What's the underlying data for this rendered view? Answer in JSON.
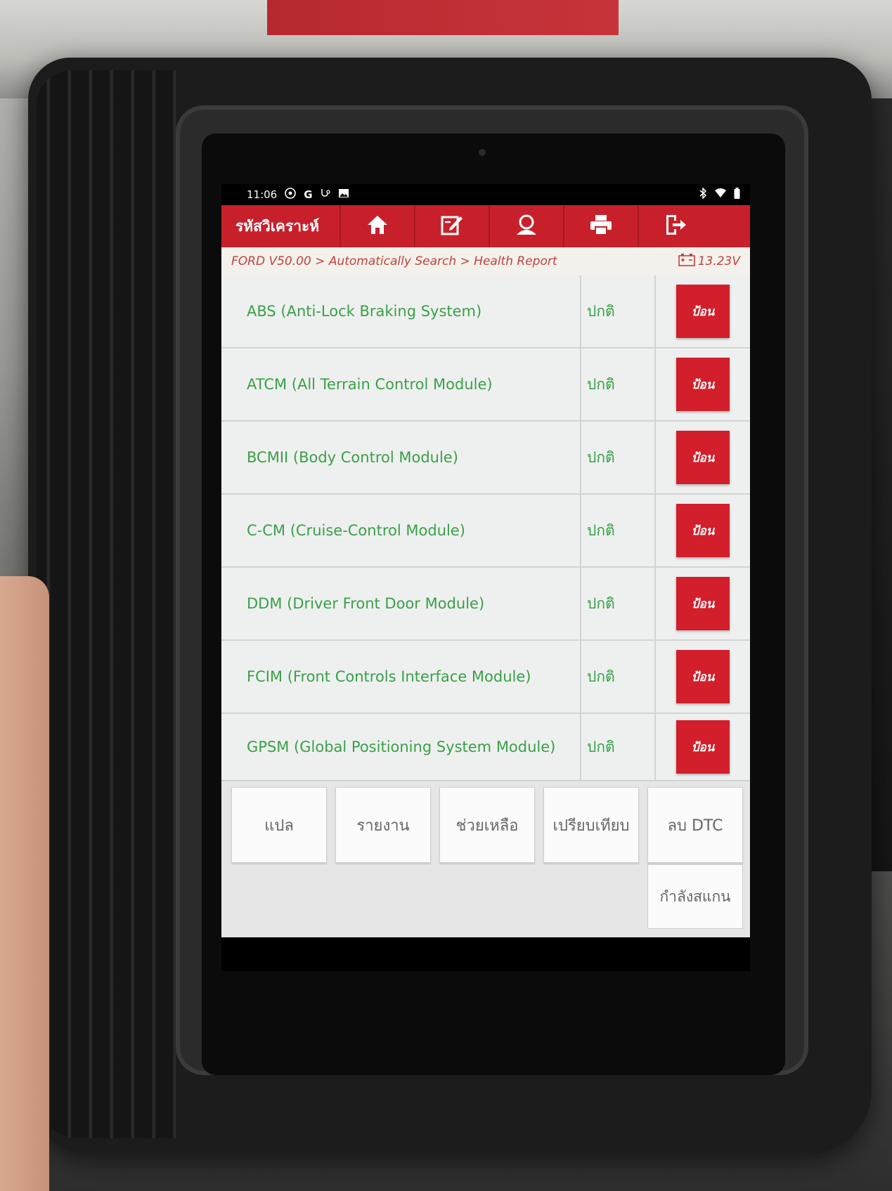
{
  "status_bar": {
    "time": "11:06",
    "left_icons": [
      "settings-icon",
      "google-icon",
      "diagnostic-icon",
      "image-icon"
    ],
    "right_icons": [
      "bluetooth-icon",
      "wifi-icon",
      "battery-icon"
    ]
  },
  "toolbar": {
    "title": "รหัสวิเคราะห์",
    "buttons": [
      "home-icon",
      "edit-icon",
      "user-icon",
      "print-icon",
      "exit-icon"
    ]
  },
  "breadcrumb": {
    "path": "FORD V50.00 > Automatically Search > Health Report",
    "voltage": "13.23V"
  },
  "modules": [
    {
      "name": "ABS (Anti-Lock Braking System)",
      "status": "ปกติ",
      "action": "ป้อน"
    },
    {
      "name": "ATCM (All Terrain Control Module)",
      "status": "ปกติ",
      "action": "ป้อน"
    },
    {
      "name": "BCMII (Body Control Module)",
      "status": "ปกติ",
      "action": "ป้อน"
    },
    {
      "name": "C-CM (Cruise-Control Module)",
      "status": "ปกติ",
      "action": "ป้อน"
    },
    {
      "name": "DDM (Driver Front Door Module)",
      "status": "ปกติ",
      "action": "ป้อน"
    },
    {
      "name": "FCIM (Front Controls Interface Module)",
      "status": "ปกติ",
      "action": "ป้อน"
    },
    {
      "name": "GPSM (Global Positioning System Module)",
      "status": "ปกติ",
      "action": "ป้อน"
    }
  ],
  "function_buttons": {
    "translate": "แปล",
    "report": "รายงาน",
    "help": "ช่วยเหลือ",
    "compare": "เปรียบเทียบ",
    "clear_dtc": "ลบ DTC",
    "scanning": "กำลังสแกน"
  },
  "colors": {
    "toolbar_red": "#c8202b",
    "status_green": "#3aa048",
    "breadcrumb_red": "#c3413f"
  }
}
